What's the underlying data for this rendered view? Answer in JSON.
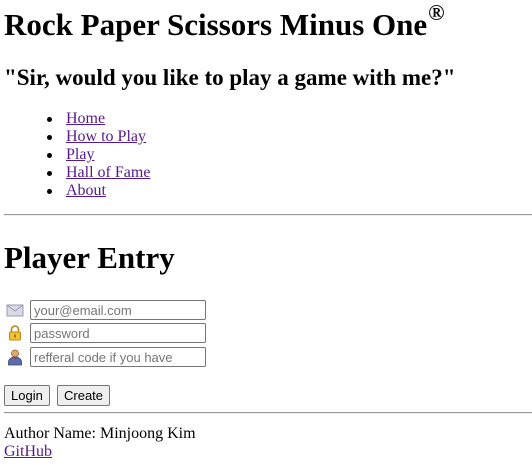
{
  "header": {
    "title": "Rock Paper Scissors Minus One",
    "registered_mark": "®",
    "tagline": "\"Sir, would you like to play a game with me?\""
  },
  "nav": {
    "items": [
      {
        "label": "Home"
      },
      {
        "label": "How to Play"
      },
      {
        "label": "Play"
      },
      {
        "label": "Hall of Fame"
      },
      {
        "label": "About"
      }
    ],
    "link_color": "#551a8b"
  },
  "main": {
    "section_title": "Player Entry",
    "fields": {
      "email": {
        "icon": "envelope-icon",
        "value": "",
        "placeholder": "your@email.com"
      },
      "password": {
        "icon": "lock-icon",
        "value": "",
        "placeholder": "password"
      },
      "referral": {
        "icon": "person-icon",
        "value": "",
        "placeholder": "refferal code if you have"
      }
    },
    "buttons": {
      "login_label": "Login",
      "create_label": "Create"
    }
  },
  "footer": {
    "author": "Author Name: Minjoong Kim",
    "github_label": "GitHub"
  }
}
